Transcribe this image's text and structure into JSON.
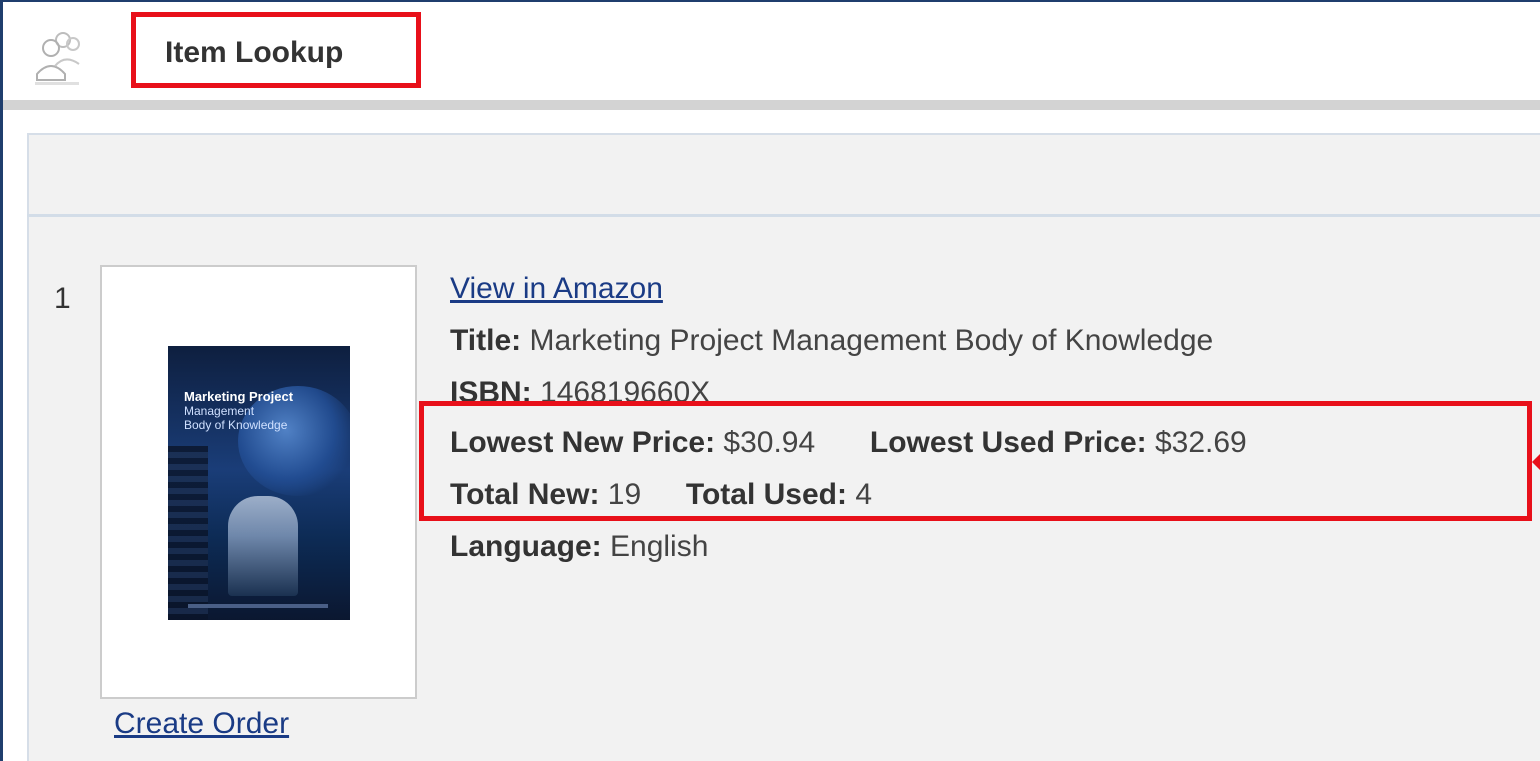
{
  "header": {
    "title": "Item Lookup",
    "icon": "users-icon"
  },
  "item": {
    "index": "1",
    "view_link": "View in Amazon",
    "title_label": "Title:",
    "title_value": "Marketing Project Management Body of Knowledge",
    "isbn_label": "ISBN:",
    "isbn_value": "146819660X",
    "lowest_new_label": "Lowest New Price:",
    "lowest_new_value": "$30.94",
    "lowest_used_label": "Lowest Used Price:",
    "lowest_used_value": "$32.69",
    "total_new_label": "Total New:",
    "total_new_value": "19",
    "total_used_label": "Total Used:",
    "total_used_value": "4",
    "language_label": "Language:",
    "language_value": "English",
    "create_order": "Create Order",
    "cover": {
      "title": "Marketing Project",
      "subtitle": "Management\nBody of Knowledge"
    }
  },
  "colors": {
    "highlight": "#e8101a",
    "link": "#1a3b85",
    "panel_bg": "#f2f2f2",
    "frame": "#1f3e6d"
  }
}
